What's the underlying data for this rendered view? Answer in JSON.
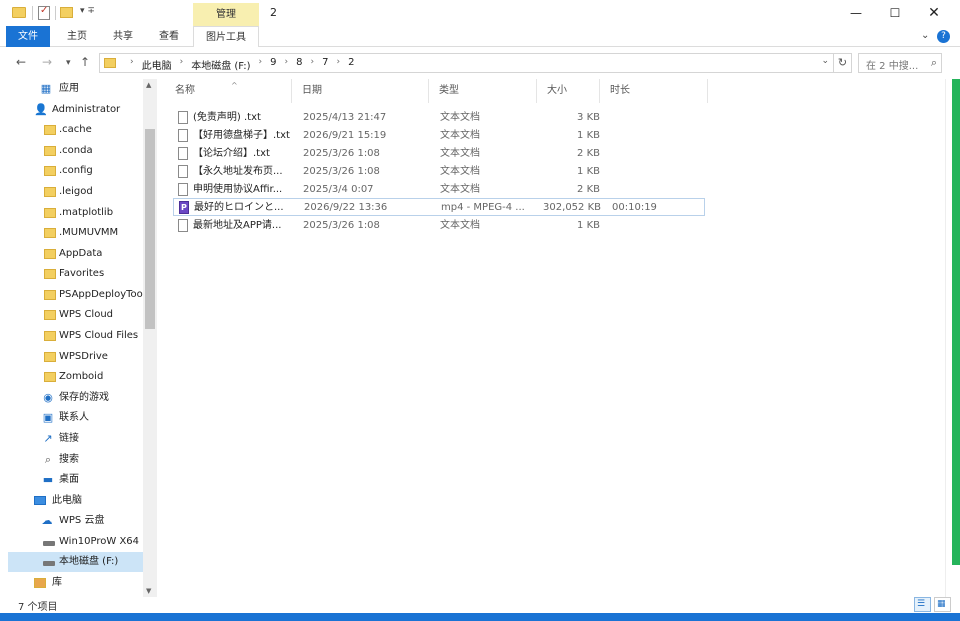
{
  "window": {
    "title": "2",
    "manage_tab": "管理",
    "minimize": "—",
    "maximize": "☐",
    "close": "✕"
  },
  "quick_access": {
    "dropdown": "▾ ∓"
  },
  "ribbon": {
    "tabs": [
      "文件",
      "主页",
      "共享",
      "查看",
      "图片工具"
    ],
    "expand": "⌄",
    "help": "?"
  },
  "nav": {
    "back": "←",
    "forward": "→",
    "recent": "▾",
    "up": "↑",
    "breadcrumbs": [
      "此电脑",
      "本地磁盘 (F:)",
      "9",
      "8",
      "7",
      "2"
    ],
    "address_dropdown": "⌄",
    "refresh": "↻",
    "search_placeholder": "在 2 中搜...",
    "search_icon": "⌕"
  },
  "sidebar": {
    "items": [
      {
        "label": "应用",
        "icon": "apps-icon",
        "glyph": "▦"
      },
      {
        "label": "Administrator",
        "icon": "user-icon",
        "glyph": "👤"
      },
      {
        "label": ".cache",
        "icon": "folder-icon"
      },
      {
        "label": ".conda",
        "icon": "folder-icon"
      },
      {
        "label": ".config",
        "icon": "folder-icon"
      },
      {
        "label": ".leigod",
        "icon": "folder-icon"
      },
      {
        "label": ".matplotlib",
        "icon": "folder-icon"
      },
      {
        "label": ".MUMUVMM",
        "icon": "folder-icon"
      },
      {
        "label": "AppData",
        "icon": "folder-icon"
      },
      {
        "label": "Favorites",
        "icon": "folder-icon"
      },
      {
        "label": "PSAppDeployToo",
        "icon": "folder-icon"
      },
      {
        "label": "WPS Cloud",
        "icon": "folder-icon"
      },
      {
        "label": "WPS Cloud Files",
        "icon": "folder-icon"
      },
      {
        "label": "WPSDrive",
        "icon": "folder-icon"
      },
      {
        "label": "Zomboid",
        "icon": "folder-icon"
      },
      {
        "label": "保存的游戏",
        "icon": "saved-games-icon",
        "glyph": "◉"
      },
      {
        "label": "联系人",
        "icon": "contacts-icon",
        "glyph": "▣"
      },
      {
        "label": "链接",
        "icon": "links-icon",
        "glyph": "↗"
      },
      {
        "label": "搜索",
        "icon": "search-icon",
        "glyph": "⌕"
      },
      {
        "label": "桌面",
        "icon": "desktop-icon",
        "glyph": "▬"
      },
      {
        "label": "此电脑",
        "icon": "this-pc-icon"
      },
      {
        "label": "WPS 云盘",
        "icon": "cloud-icon",
        "glyph": "☁"
      },
      {
        "label": "Win10ProW X64",
        "icon": "drive-icon"
      },
      {
        "label": "本地磁盘 (F:)",
        "icon": "drive-icon",
        "selected": true
      },
      {
        "label": "库",
        "icon": "library-icon"
      }
    ]
  },
  "filelist": {
    "columns": [
      "名称",
      "日期",
      "类型",
      "大小",
      "时长"
    ],
    "sort_indicator": "^",
    "rows": [
      {
        "name": "(免责声明) .txt",
        "date": "2025/4/13 21:47",
        "type": "文本文档",
        "size": "3 KB",
        "duration": "",
        "kind": "text"
      },
      {
        "name": "【好用德盘梯子】.txt",
        "date": "2026/9/21 15:19",
        "type": "文本文档",
        "size": "1 KB",
        "duration": "",
        "kind": "text"
      },
      {
        "name": "【论坛介绍】.txt",
        "date": "2025/3/26 1:08",
        "type": "文本文档",
        "size": "2 KB",
        "duration": "",
        "kind": "text"
      },
      {
        "name": "【永久地址发布页...",
        "date": "2025/3/26 1:08",
        "type": "文本文档",
        "size": "1 KB",
        "duration": "",
        "kind": "text"
      },
      {
        "name": "申明使用协议Affir...",
        "date": "2025/3/4 0:07",
        "type": "文本文档",
        "size": "2 KB",
        "duration": "",
        "kind": "text"
      },
      {
        "name": "最好的ヒロインと...",
        "date": "2026/9/22 13:36",
        "type": "mp4 - MPEG-4 ...",
        "size": "302,052 KB",
        "duration": "00:10:19",
        "kind": "video",
        "highlighted": true
      },
      {
        "name": "最新地址及APP请...",
        "date": "2025/3/26 1:08",
        "type": "文本文档",
        "size": "1 KB",
        "duration": "",
        "kind": "text"
      }
    ]
  },
  "status": {
    "count": "7 个项目",
    "details_view": "☰",
    "tiles_view": "▦"
  },
  "colors": {
    "accent": "#1a73d4",
    "manage_tab_bg": "#f8efb0",
    "selection": "#cce4f7",
    "folder": "#f3cf60",
    "green_bar": "#25b45b"
  }
}
